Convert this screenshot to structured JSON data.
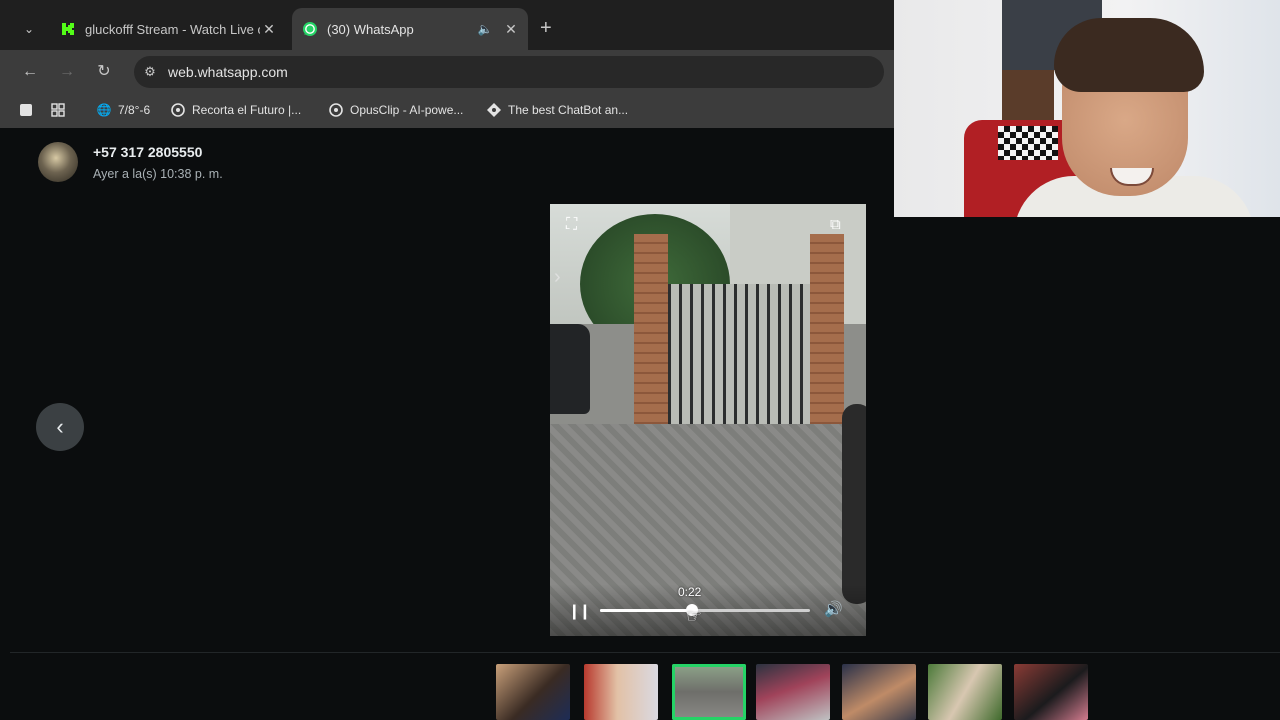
{
  "browser": {
    "tabs": [
      {
        "title": "gluckofff Stream - Watch Live o",
        "favicon": "kick-logo-icon",
        "active": false
      },
      {
        "title": "(30) WhatsApp",
        "favicon": "whatsapp-logo-icon",
        "active": true
      }
    ],
    "url": "web.whatsapp.com",
    "bookmarks": [
      {
        "label": "7/8°-6",
        "icon": "globe-icon"
      },
      {
        "label": "Recorta el Futuro |...",
        "icon": "opusclip-icon"
      },
      {
        "label": "OpusClip - AI-powe...",
        "icon": "opusclip-icon"
      },
      {
        "label": "The best ChatBot an...",
        "icon": "chatbot-icon"
      }
    ],
    "accent": "#3c3c3c"
  },
  "viewer": {
    "sender": "+57 317 2805550",
    "timestamp": "Ayer a la(s) 10:38 p. m.",
    "video": {
      "current_time": "0:22",
      "progress_fraction": 0.44,
      "playing": true
    },
    "thumbnails_count": 7,
    "selected_thumbnail": 3,
    "selection_color": "#25d366"
  }
}
